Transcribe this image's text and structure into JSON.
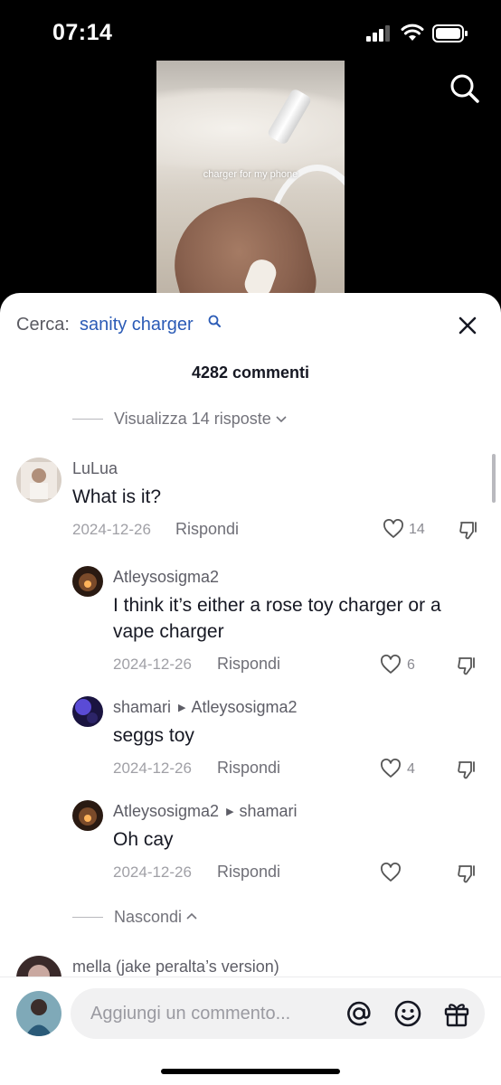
{
  "status_bar": {
    "time": "07:14"
  },
  "video": {
    "caption": "charger for my phone"
  },
  "sheet": {
    "search_label": "Cerca:",
    "search_term": "sanity charger",
    "comment_count": "4282 commenti",
    "view_replies": "Visualizza 14 risposte",
    "hide": "Nascondi"
  },
  "comments": [
    {
      "username": "LuLua",
      "text": "What is it?",
      "date": "2024-12-26",
      "reply_label": "Rispondi",
      "likes": "14"
    },
    {
      "username": "Atleysosigma2",
      "text": "I think it’s either a rose toy charger or a vape charger",
      "date": "2024-12-26",
      "reply_label": "Rispondi",
      "likes": "6"
    },
    {
      "username": "shamari",
      "reply_to": "Atleysosigma2",
      "text": "seggs toy",
      "date": "2024-12-26",
      "reply_label": "Rispondi",
      "likes": "4"
    },
    {
      "username": "Atleysosigma2",
      "reply_to": "shamari",
      "text": "Oh cay",
      "date": "2024-12-26",
      "reply_label": "Rispondi",
      "likes": ""
    },
    {
      "username": "mella (jake peralta’s version)"
    }
  ],
  "input": {
    "placeholder": "Aggiungi un commento..."
  },
  "icons": {
    "search": "search-icon",
    "close": "close-icon",
    "like": "heart-icon",
    "dislike": "thumbs-down-icon",
    "mention": "at-icon",
    "emoji": "emoji-icon",
    "gift": "gift-icon"
  },
  "colors": {
    "search_term": "#2b5bb6",
    "sheet_bg": "#ffffff",
    "background": "#000000"
  }
}
